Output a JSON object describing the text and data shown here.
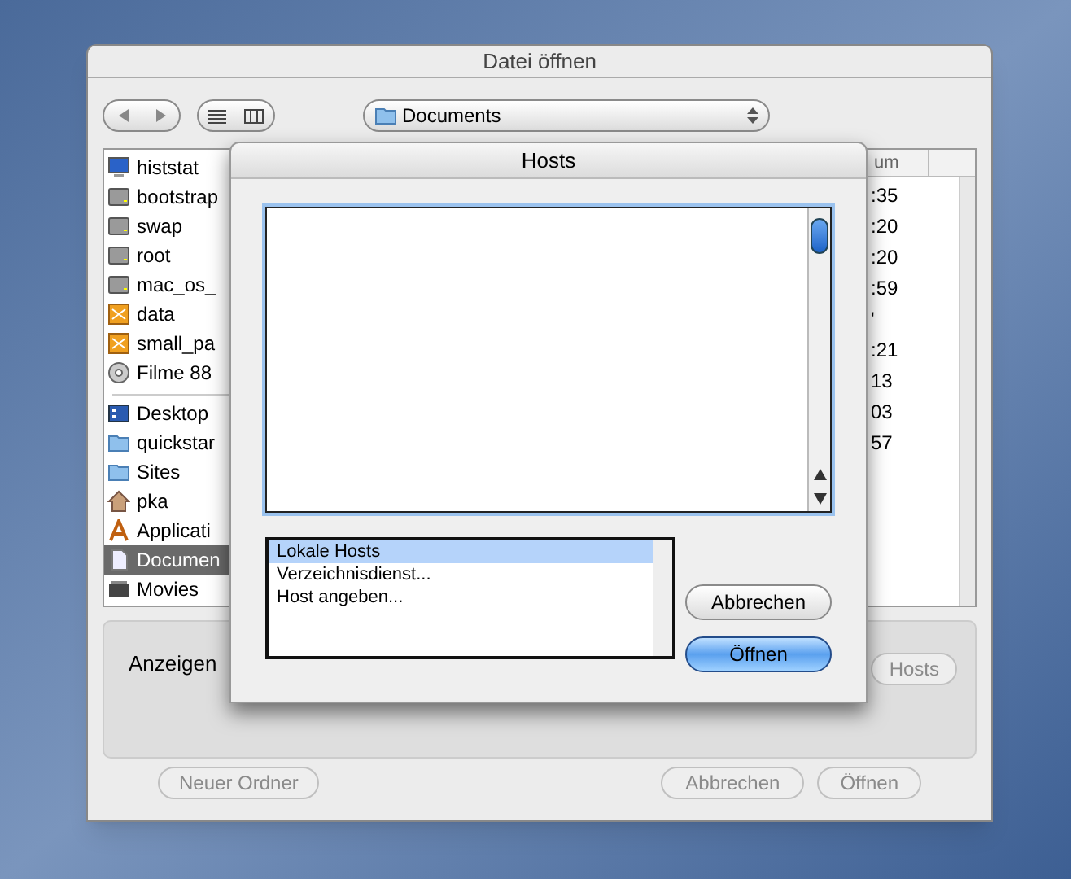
{
  "window": {
    "title": "Datei öffnen"
  },
  "toolbar": {
    "location": "Documents"
  },
  "sidebar": {
    "items": [
      {
        "label": "histstat",
        "kind": "monitor",
        "selected": false
      },
      {
        "label": "bootstrap",
        "kind": "drive",
        "selected": false
      },
      {
        "label": "swap",
        "kind": "drive",
        "selected": false
      },
      {
        "label": "root",
        "kind": "drive",
        "selected": false
      },
      {
        "label": "mac_os_",
        "kind": "drive",
        "selected": false
      },
      {
        "label": "data",
        "kind": "share",
        "selected": false
      },
      {
        "label": "small_pa",
        "kind": "share",
        "selected": false
      },
      {
        "label": "Filme 88",
        "kind": "disc",
        "selected": false
      },
      {
        "label": "Desktop",
        "kind": "desktop",
        "selected": false
      },
      {
        "label": "quickstar",
        "kind": "folder",
        "selected": false
      },
      {
        "label": "Sites",
        "kind": "folder",
        "selected": false
      },
      {
        "label": "pka",
        "kind": "home",
        "selected": false
      },
      {
        "label": "Applicati",
        "kind": "apps",
        "selected": false
      },
      {
        "label": "Documen",
        "kind": "document",
        "selected": true
      },
      {
        "label": "Movies",
        "kind": "movies",
        "selected": false
      }
    ]
  },
  "file_list": {
    "column_header": "um",
    "dates": [
      ":35",
      ":20",
      ":20",
      ":59",
      "'",
      ":21",
      "13",
      "03",
      "57"
    ]
  },
  "options": {
    "label": "Anzeigen",
    "hosts_button": "Hosts"
  },
  "buttons": {
    "new_folder": "Neuer Ordner",
    "cancel": "Abbrechen",
    "open": "Öffnen"
  },
  "hosts_dialog": {
    "title": "Hosts",
    "sources": [
      {
        "label": "Lokale Hosts",
        "selected": true
      },
      {
        "label": "Verzeichnisdienst...",
        "selected": false
      },
      {
        "label": "Host angeben...",
        "selected": false
      }
    ],
    "cancel": "Abbrechen",
    "open": "Öffnen"
  }
}
